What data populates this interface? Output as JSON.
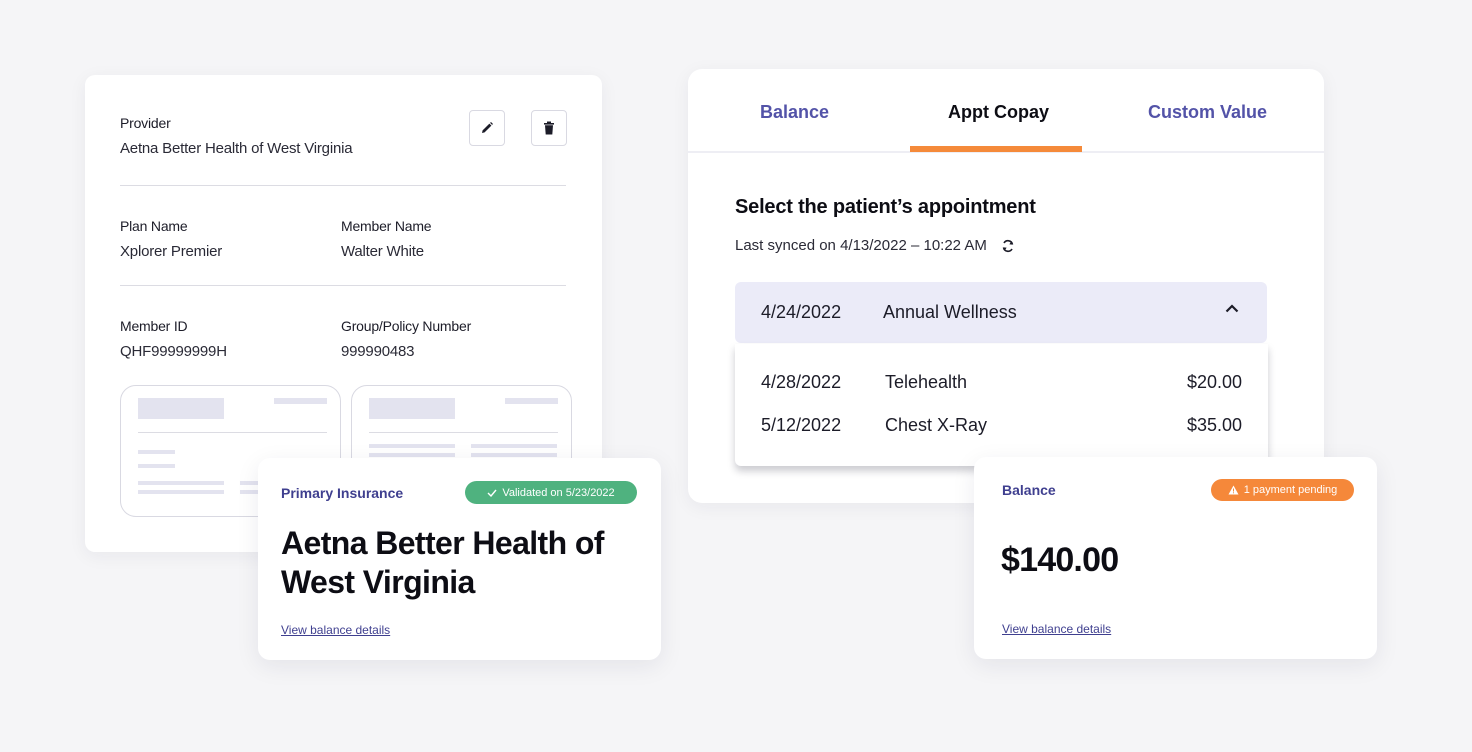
{
  "provider_card": {
    "provider_label": "Provider",
    "provider_value": "Aetna Better Health of West Virginia",
    "plan_label": "Plan Name",
    "plan_value": "Xplorer Premier",
    "member_name_label": "Member Name",
    "member_name_value": "Walter White",
    "member_id_label": "Member ID",
    "member_id_value": "QHF99999999H",
    "group_label": "Group/Policy Number",
    "group_value": "999990483",
    "icons": [
      "pencil-icon",
      "trash-icon"
    ]
  },
  "insurance_card": {
    "label": "Primary Insurance",
    "badge": "Validated on 5/23/2022",
    "name": "Aetna Better Health of West Virginia",
    "link": "View balance details",
    "badge_color": "#4fb27f"
  },
  "copay_card": {
    "tabs": [
      {
        "label": "Balance"
      },
      {
        "label": "Appt Copay",
        "active": true
      },
      {
        "label": "Custom Value"
      }
    ],
    "title": "Select the patient’s appointment",
    "sync_text": "Last synced on 4/13/2022 – 10:22 AM",
    "selected": {
      "date": "4/24/2022",
      "name": "Annual Wellness"
    },
    "options": [
      {
        "date": "4/28/2022",
        "name": "Telehealth",
        "amount": "$20.00"
      },
      {
        "date": "5/12/2022",
        "name": "Chest X-Ray",
        "amount": "$35.00"
      }
    ],
    "accent_color": "#f58a3a"
  },
  "balance_card": {
    "label": "Balance",
    "badge": "1 payment pending",
    "amount": "$140.00",
    "link": "View balance details",
    "badge_color": "#f5883a"
  }
}
